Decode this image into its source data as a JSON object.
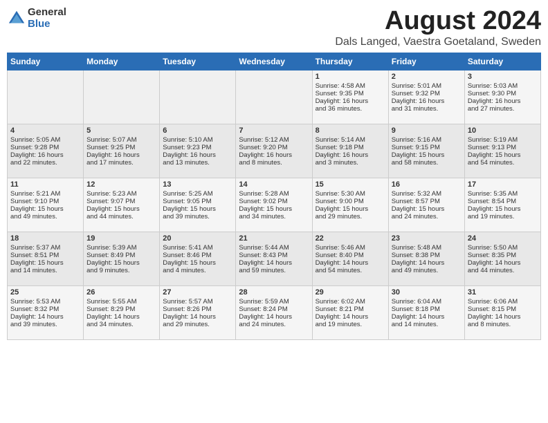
{
  "header": {
    "logo_general": "General",
    "logo_blue": "Blue",
    "month_title": "August 2024",
    "location": "Dals Langed, Vaestra Goetaland, Sweden"
  },
  "days_of_week": [
    "Sunday",
    "Monday",
    "Tuesday",
    "Wednesday",
    "Thursday",
    "Friday",
    "Saturday"
  ],
  "weeks": [
    [
      {
        "day": "",
        "info": ""
      },
      {
        "day": "",
        "info": ""
      },
      {
        "day": "",
        "info": ""
      },
      {
        "day": "",
        "info": ""
      },
      {
        "day": "1",
        "info": "Sunrise: 4:58 AM\nSunset: 9:35 PM\nDaylight: 16 hours\nand 36 minutes."
      },
      {
        "day": "2",
        "info": "Sunrise: 5:01 AM\nSunset: 9:32 PM\nDaylight: 16 hours\nand 31 minutes."
      },
      {
        "day": "3",
        "info": "Sunrise: 5:03 AM\nSunset: 9:30 PM\nDaylight: 16 hours\nand 27 minutes."
      }
    ],
    [
      {
        "day": "4",
        "info": "Sunrise: 5:05 AM\nSunset: 9:28 PM\nDaylight: 16 hours\nand 22 minutes."
      },
      {
        "day": "5",
        "info": "Sunrise: 5:07 AM\nSunset: 9:25 PM\nDaylight: 16 hours\nand 17 minutes."
      },
      {
        "day": "6",
        "info": "Sunrise: 5:10 AM\nSunset: 9:23 PM\nDaylight: 16 hours\nand 13 minutes."
      },
      {
        "day": "7",
        "info": "Sunrise: 5:12 AM\nSunset: 9:20 PM\nDaylight: 16 hours\nand 8 minutes."
      },
      {
        "day": "8",
        "info": "Sunrise: 5:14 AM\nSunset: 9:18 PM\nDaylight: 16 hours\nand 3 minutes."
      },
      {
        "day": "9",
        "info": "Sunrise: 5:16 AM\nSunset: 9:15 PM\nDaylight: 15 hours\nand 58 minutes."
      },
      {
        "day": "10",
        "info": "Sunrise: 5:19 AM\nSunset: 9:13 PM\nDaylight: 15 hours\nand 54 minutes."
      }
    ],
    [
      {
        "day": "11",
        "info": "Sunrise: 5:21 AM\nSunset: 9:10 PM\nDaylight: 15 hours\nand 49 minutes."
      },
      {
        "day": "12",
        "info": "Sunrise: 5:23 AM\nSunset: 9:07 PM\nDaylight: 15 hours\nand 44 minutes."
      },
      {
        "day": "13",
        "info": "Sunrise: 5:25 AM\nSunset: 9:05 PM\nDaylight: 15 hours\nand 39 minutes."
      },
      {
        "day": "14",
        "info": "Sunrise: 5:28 AM\nSunset: 9:02 PM\nDaylight: 15 hours\nand 34 minutes."
      },
      {
        "day": "15",
        "info": "Sunrise: 5:30 AM\nSunset: 9:00 PM\nDaylight: 15 hours\nand 29 minutes."
      },
      {
        "day": "16",
        "info": "Sunrise: 5:32 AM\nSunset: 8:57 PM\nDaylight: 15 hours\nand 24 minutes."
      },
      {
        "day": "17",
        "info": "Sunrise: 5:35 AM\nSunset: 8:54 PM\nDaylight: 15 hours\nand 19 minutes."
      }
    ],
    [
      {
        "day": "18",
        "info": "Sunrise: 5:37 AM\nSunset: 8:51 PM\nDaylight: 15 hours\nand 14 minutes."
      },
      {
        "day": "19",
        "info": "Sunrise: 5:39 AM\nSunset: 8:49 PM\nDaylight: 15 hours\nand 9 minutes."
      },
      {
        "day": "20",
        "info": "Sunrise: 5:41 AM\nSunset: 8:46 PM\nDaylight: 15 hours\nand 4 minutes."
      },
      {
        "day": "21",
        "info": "Sunrise: 5:44 AM\nSunset: 8:43 PM\nDaylight: 14 hours\nand 59 minutes."
      },
      {
        "day": "22",
        "info": "Sunrise: 5:46 AM\nSunset: 8:40 PM\nDaylight: 14 hours\nand 54 minutes."
      },
      {
        "day": "23",
        "info": "Sunrise: 5:48 AM\nSunset: 8:38 PM\nDaylight: 14 hours\nand 49 minutes."
      },
      {
        "day": "24",
        "info": "Sunrise: 5:50 AM\nSunset: 8:35 PM\nDaylight: 14 hours\nand 44 minutes."
      }
    ],
    [
      {
        "day": "25",
        "info": "Sunrise: 5:53 AM\nSunset: 8:32 PM\nDaylight: 14 hours\nand 39 minutes."
      },
      {
        "day": "26",
        "info": "Sunrise: 5:55 AM\nSunset: 8:29 PM\nDaylight: 14 hours\nand 34 minutes."
      },
      {
        "day": "27",
        "info": "Sunrise: 5:57 AM\nSunset: 8:26 PM\nDaylight: 14 hours\nand 29 minutes."
      },
      {
        "day": "28",
        "info": "Sunrise: 5:59 AM\nSunset: 8:24 PM\nDaylight: 14 hours\nand 24 minutes."
      },
      {
        "day": "29",
        "info": "Sunrise: 6:02 AM\nSunset: 8:21 PM\nDaylight: 14 hours\nand 19 minutes."
      },
      {
        "day": "30",
        "info": "Sunrise: 6:04 AM\nSunset: 8:18 PM\nDaylight: 14 hours\nand 14 minutes."
      },
      {
        "day": "31",
        "info": "Sunrise: 6:06 AM\nSunset: 8:15 PM\nDaylight: 14 hours\nand 8 minutes."
      }
    ]
  ]
}
